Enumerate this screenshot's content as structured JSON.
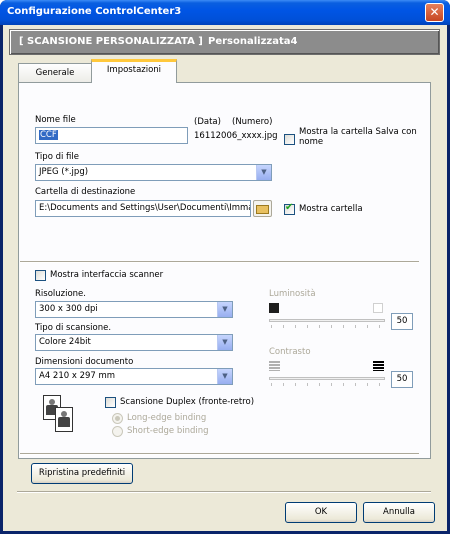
{
  "window": {
    "title": "Configurazione ControlCenter3",
    "close_glyph": "✕"
  },
  "header": {
    "mode": "[  SCANSIONE PERSONALIZZATA  ]",
    "name": "Personalizzata4"
  },
  "tabs": [
    {
      "label": "Generale",
      "active": false
    },
    {
      "label": "Impostazioni",
      "active": true
    }
  ],
  "file_name": {
    "label": "Nome file",
    "value": "CCF",
    "date_label": "(Data)",
    "number_label": "(Numero)",
    "generated": "16112006_xxxx.jpg"
  },
  "show_save_folder": {
    "label": "Mostra la cartella Salva con nome",
    "checked": false
  },
  "file_type": {
    "label": "Tipo di file",
    "value": "JPEG (*.jpg)"
  },
  "destination": {
    "label": "Cartella di destinazione",
    "value": "E:\\Documents and Settings\\User\\Documenti\\Immagini",
    "show_folder_label": "Mostra cartella",
    "show_folder_checked": true
  },
  "show_scanner_interface": {
    "label": "Mostra interfaccia scanner",
    "checked": false
  },
  "resolution": {
    "label": "Risoluzione.",
    "value": "300 x 300 dpi"
  },
  "scan_type": {
    "label": "Tipo di scansione.",
    "value": "Colore 24bit"
  },
  "document_size": {
    "label": "Dimensioni documento",
    "value": "A4 210 x 297 mm"
  },
  "brightness": {
    "label": "Luminosità",
    "value": "50",
    "level": 0.5
  },
  "contrast": {
    "label": "Contrasto",
    "value": "50",
    "level": 0.5
  },
  "duplex": {
    "label": "Scansione Duplex (fronte-retro)",
    "checked": false,
    "long_edge": "Long-edge binding",
    "short_edge": "Short-edge binding"
  },
  "reset_button": "Ripristina predefiniti",
  "ok_button": "OK",
  "cancel_button": "Annulla",
  "icons": {
    "folder": "folder-icon",
    "duplex": "duplex-document-icon",
    "dropdown": "chevron-down-icon"
  }
}
